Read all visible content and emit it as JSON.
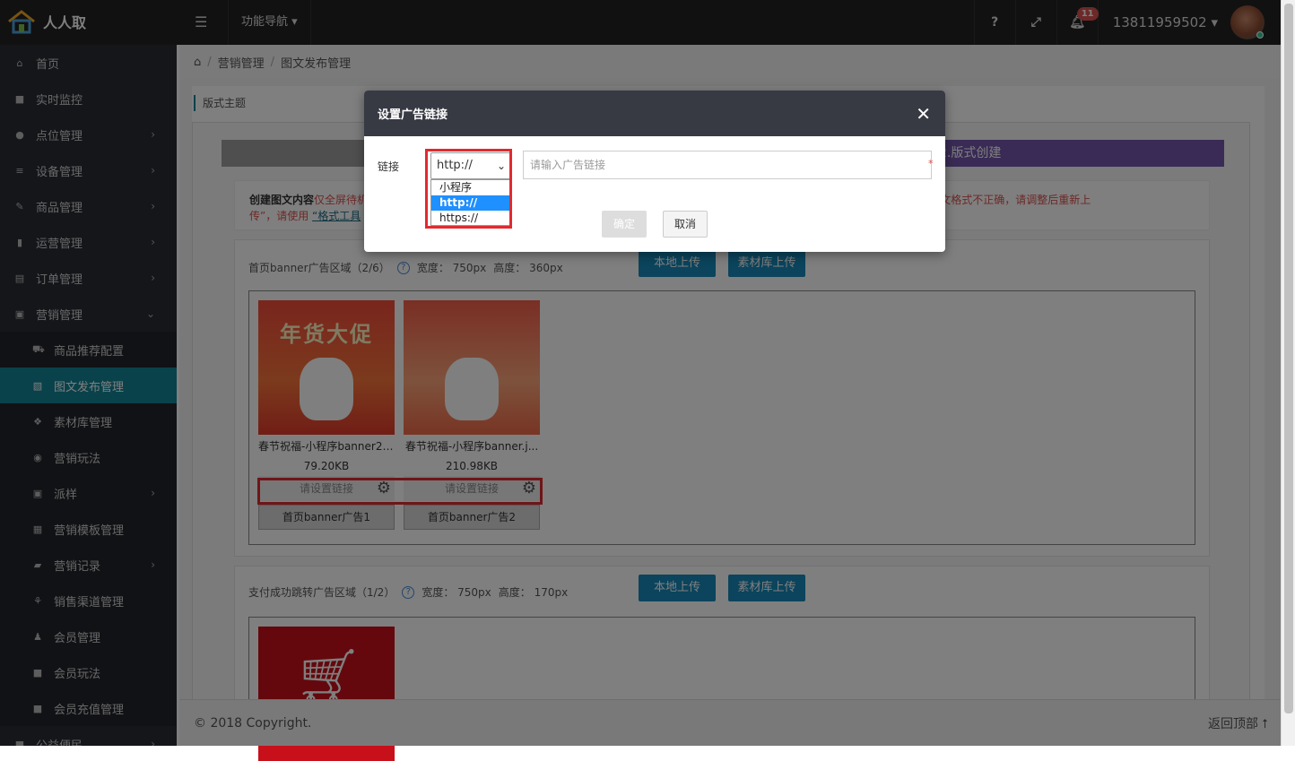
{
  "brand": {
    "name": "人人取"
  },
  "topnav": {
    "func_nav": "功能导航 ▾",
    "help": "?",
    "expand": "⤢",
    "bell_count": "11",
    "user": "13811959502 ▾"
  },
  "sidebar": {
    "items": [
      {
        "label": "首页",
        "icon": "home-icon",
        "glyph": "⌂"
      },
      {
        "label": "实时监控",
        "icon": "video-icon",
        "glyph": "■"
      },
      {
        "label": "点位管理",
        "icon": "map-pin-icon",
        "glyph": "●",
        "arrow": "›"
      },
      {
        "label": "设备管理",
        "icon": "sort-icon",
        "glyph": "≡",
        "arrow": "›"
      },
      {
        "label": "商品管理",
        "icon": "edit-icon",
        "glyph": "✎",
        "arrow": "›"
      },
      {
        "label": "运营管理",
        "icon": "bookmark-icon",
        "glyph": "▮",
        "arrow": "›"
      },
      {
        "label": "订单管理",
        "icon": "list-icon",
        "glyph": "▤",
        "arrow": "›"
      },
      {
        "label": "营销管理",
        "icon": "gift-icon",
        "glyph": "▣",
        "arrow": "⌄"
      },
      {
        "label": "商品推荐配置",
        "icon": "cart-icon",
        "glyph": "⛟",
        "sub": true
      },
      {
        "label": "图文发布管理",
        "icon": "image-icon",
        "glyph": "▧",
        "sub": true,
        "active": true
      },
      {
        "label": "素材库管理",
        "icon": "cubes-icon",
        "glyph": "❖",
        "sub": true
      },
      {
        "label": "营销玩法",
        "icon": "gamepad-icon",
        "glyph": "◉",
        "sub": true
      },
      {
        "label": "派样",
        "icon": "gift-icon",
        "glyph": "▣",
        "sub": true,
        "arrow": "›"
      },
      {
        "label": "营销模板管理",
        "icon": "table-icon",
        "glyph": "▦",
        "sub": true
      },
      {
        "label": "营销记录",
        "icon": "book-icon",
        "glyph": "▰",
        "sub": true,
        "arrow": "›"
      },
      {
        "label": "销售渠道管理",
        "icon": "sitemap-icon",
        "glyph": "⚘",
        "sub": true
      },
      {
        "label": "会员管理",
        "icon": "users-icon",
        "glyph": "♟",
        "sub": true
      },
      {
        "label": "会员玩法",
        "icon": "square-icon",
        "glyph": "■",
        "sub": true
      },
      {
        "label": "会员充值管理",
        "icon": "square-icon",
        "glyph": "■",
        "sub": true
      },
      {
        "label": "公益便民",
        "icon": "square-icon",
        "glyph": "■",
        "arrow": "›"
      }
    ]
  },
  "breadcrumb": {
    "home": "⌂",
    "sep1": "/",
    "item1": "营销管理",
    "sep2": "/",
    "item2": "图文发布管理"
  },
  "section_title": "版式主题",
  "steps": {
    "step2": "2.版式创建"
  },
  "notice": {
    "label": "创建图文内容",
    "red1": "仅全屏待机",
    "red2": "。如若提示“图文格式不正确，请调整后重新上",
    "red3": "传”，请使用",
    "link": "“格式工具"
  },
  "area1": {
    "title": "首页banner广告区域（2/6）",
    "width": "宽度：  750px",
    "height": "高度：  360px",
    "upload_local": "本地上传",
    "upload_lib": "素材库上传",
    "cards": [
      {
        "thumb_text": "年货大促",
        "name": "春节祝福-小程序banner2....",
        "size": "79.20KB",
        "link": "请设置链接",
        "slot": "首页banner广告1"
      },
      {
        "thumb_text": "",
        "name": "春节祝福-小程序banner.j...",
        "size": "210.98KB",
        "link": "请设置链接",
        "slot": "首页banner广告2"
      }
    ]
  },
  "area2": {
    "title": "支付成功跳转广告区域（1/2）",
    "width": "宽度：  750px",
    "height": "高度：  170px",
    "upload_local": "本地上传",
    "upload_lib": "素材库上传"
  },
  "footer": {
    "copyright": "© 2018 Copyright.",
    "back_top": "返回顶部 ⭡"
  },
  "modal": {
    "title": "设置广告链接",
    "close": "✕",
    "label": "链接",
    "select_value": "http://",
    "options": [
      "小程序",
      "http://",
      "https://"
    ],
    "url_placeholder": "请输入广告链接",
    "required": "*",
    "ok": "确定",
    "cancel": "取消"
  },
  "colors": {
    "accent": "#138496",
    "sidebar": "#2a2d35",
    "topbar": "#222222",
    "highlight": "#e02a30",
    "select_blue": "#1e90ff"
  }
}
